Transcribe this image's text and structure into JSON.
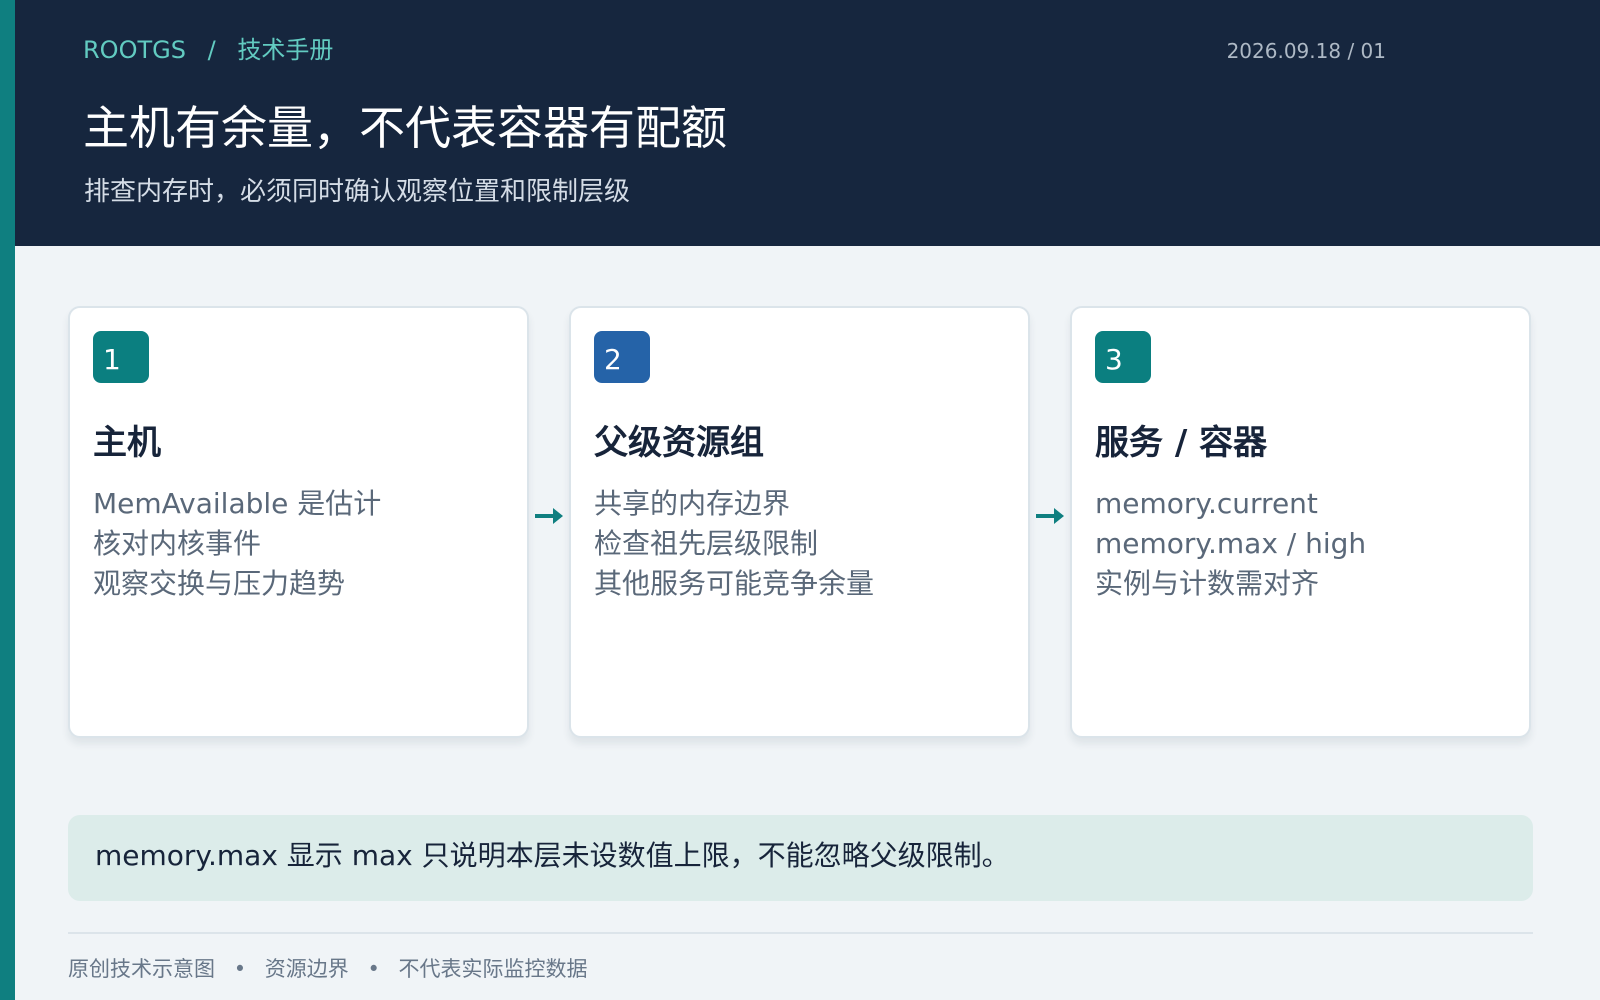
{
  "header": {
    "brand": "ROOTGS",
    "separator": "/",
    "section": "技术手册",
    "date_page": "2026.09.18 / 01",
    "title": "主机有余量，不代表容器有配额",
    "subtitle": "排查内存时，必须同时确认观察位置和限制层级"
  },
  "cards": [
    {
      "number": "1",
      "badge_color": "#0b7f80",
      "title": "主机",
      "lines": [
        "MemAvailable 是估计",
        "核对内核事件",
        "观察交换与压力趋势"
      ]
    },
    {
      "number": "2",
      "badge_color": "#2563a8",
      "title": "父级资源组",
      "lines": [
        "共享的内存边界",
        "检查祖先层级限制",
        "其他服务可能竞争余量"
      ]
    },
    {
      "number": "3",
      "badge_color": "#0b7f80",
      "title": "服务 / 容器",
      "lines": [
        "memory.current",
        "memory.max / high",
        "实例与计数需对齐"
      ]
    }
  ],
  "connectors": {
    "arrow_color": "#0f7f80",
    "icon": "arrow-right-icon"
  },
  "note": {
    "text": "memory.max 显示 max 只说明本层未设数值上限，不能忽略父级限制。"
  },
  "footer": {
    "items": [
      "原创技术示意图",
      "资源边界",
      "不代表实际监控数据"
    ],
    "separator": "•"
  },
  "colors": {
    "sidebar_accent": "#0f7f80",
    "header_bg": "#16263e",
    "breadcrumb": "#62cbc1",
    "page_bg": "#f0f4f7",
    "note_bg": "#dcecea"
  }
}
